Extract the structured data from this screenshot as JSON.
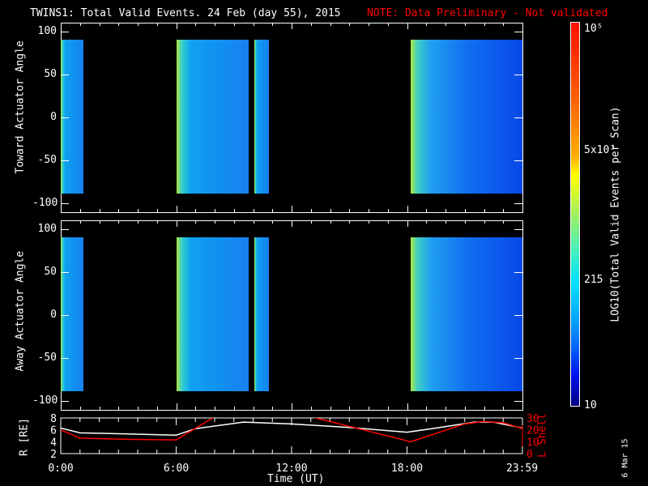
{
  "title": "TWINS1: Total Valid Events. 24 Feb (day  55), 2015",
  "note": "NOTE: Data Preliminary - Not validated",
  "date_stamp": "6 Mar 15",
  "colors": {
    "note": "#ff0000",
    "lshell": "#ff0000",
    "rline": "#ffffff"
  },
  "chart_data": [
    {
      "type": "heatmap",
      "name": "toward",
      "ylabel": "Toward Actuator Angle",
      "ylim": [
        -110,
        110
      ],
      "yticks": [
        "100",
        "50",
        "0",
        "-50",
        "-100"
      ],
      "xlim_hours": [
        0,
        24
      ],
      "blocks": [
        {
          "start_h": 0,
          "end_h": 1.17,
          "level": "mid"
        },
        {
          "start_h": 6,
          "end_h": 9.75,
          "level": "mid"
        },
        {
          "start_h": 10.08,
          "end_h": 10.83,
          "level": "mid"
        },
        {
          "start_h": 18.17,
          "end_h": 24,
          "level": "low"
        }
      ],
      "angle_range": [
        -88,
        90
      ]
    },
    {
      "type": "heatmap",
      "name": "away",
      "ylabel": "Away Actuator Angle",
      "ylim": [
        -110,
        110
      ],
      "yticks": [
        "100",
        "50",
        "0",
        "-50",
        "-100"
      ],
      "xlim_hours": [
        0,
        24
      ],
      "blocks": [
        {
          "start_h": 0,
          "end_h": 1.17,
          "level": "mid"
        },
        {
          "start_h": 6,
          "end_h": 9.75,
          "level": "mid"
        },
        {
          "start_h": 10.08,
          "end_h": 10.83,
          "level": "mid"
        },
        {
          "start_h": 18.17,
          "end_h": 24,
          "level": "low"
        }
      ],
      "angle_range": [
        -88,
        90
      ]
    },
    {
      "type": "line",
      "name": "orbit",
      "ylabel": "R [RE]",
      "y2label": "L Shell",
      "xlabel": "Time (UT)",
      "ylim": [
        2,
        8
      ],
      "y2lim": [
        0,
        30
      ],
      "xticks": [
        "0:00",
        "6:00",
        "12:00",
        "18:00",
        "23:59"
      ],
      "yticks": [
        "8",
        "6",
        "4",
        "2"
      ],
      "y2ticks": [
        "30",
        "20",
        "10",
        "0"
      ],
      "series": [
        {
          "name": "R",
          "axis": "left",
          "x": [
            0,
            1,
            3.5,
            6,
            7,
            9.5,
            12,
            15,
            18,
            19.5,
            21.5,
            22.5,
            24
          ],
          "y": [
            6.3,
            5.5,
            5.3,
            5.1,
            6.2,
            7.3,
            7.0,
            6.4,
            5.6,
            6.3,
            7.3,
            7.3,
            6.3
          ]
        },
        {
          "name": "L Shell",
          "axis": "right",
          "x": [
            0,
            1,
            3.5,
            6,
            8,
            13,
            18.2,
            21,
            22,
            23,
            24
          ],
          "y": [
            20,
            13,
            12,
            11.5,
            31,
            31,
            10,
            25,
            27,
            26,
            21
          ]
        }
      ]
    },
    {
      "type": "colorbar",
      "label": "LOG10(Total Valid Events per Scan)",
      "ticks": [
        "10",
        "215",
        "5x10³",
        "10⁵"
      ]
    }
  ]
}
